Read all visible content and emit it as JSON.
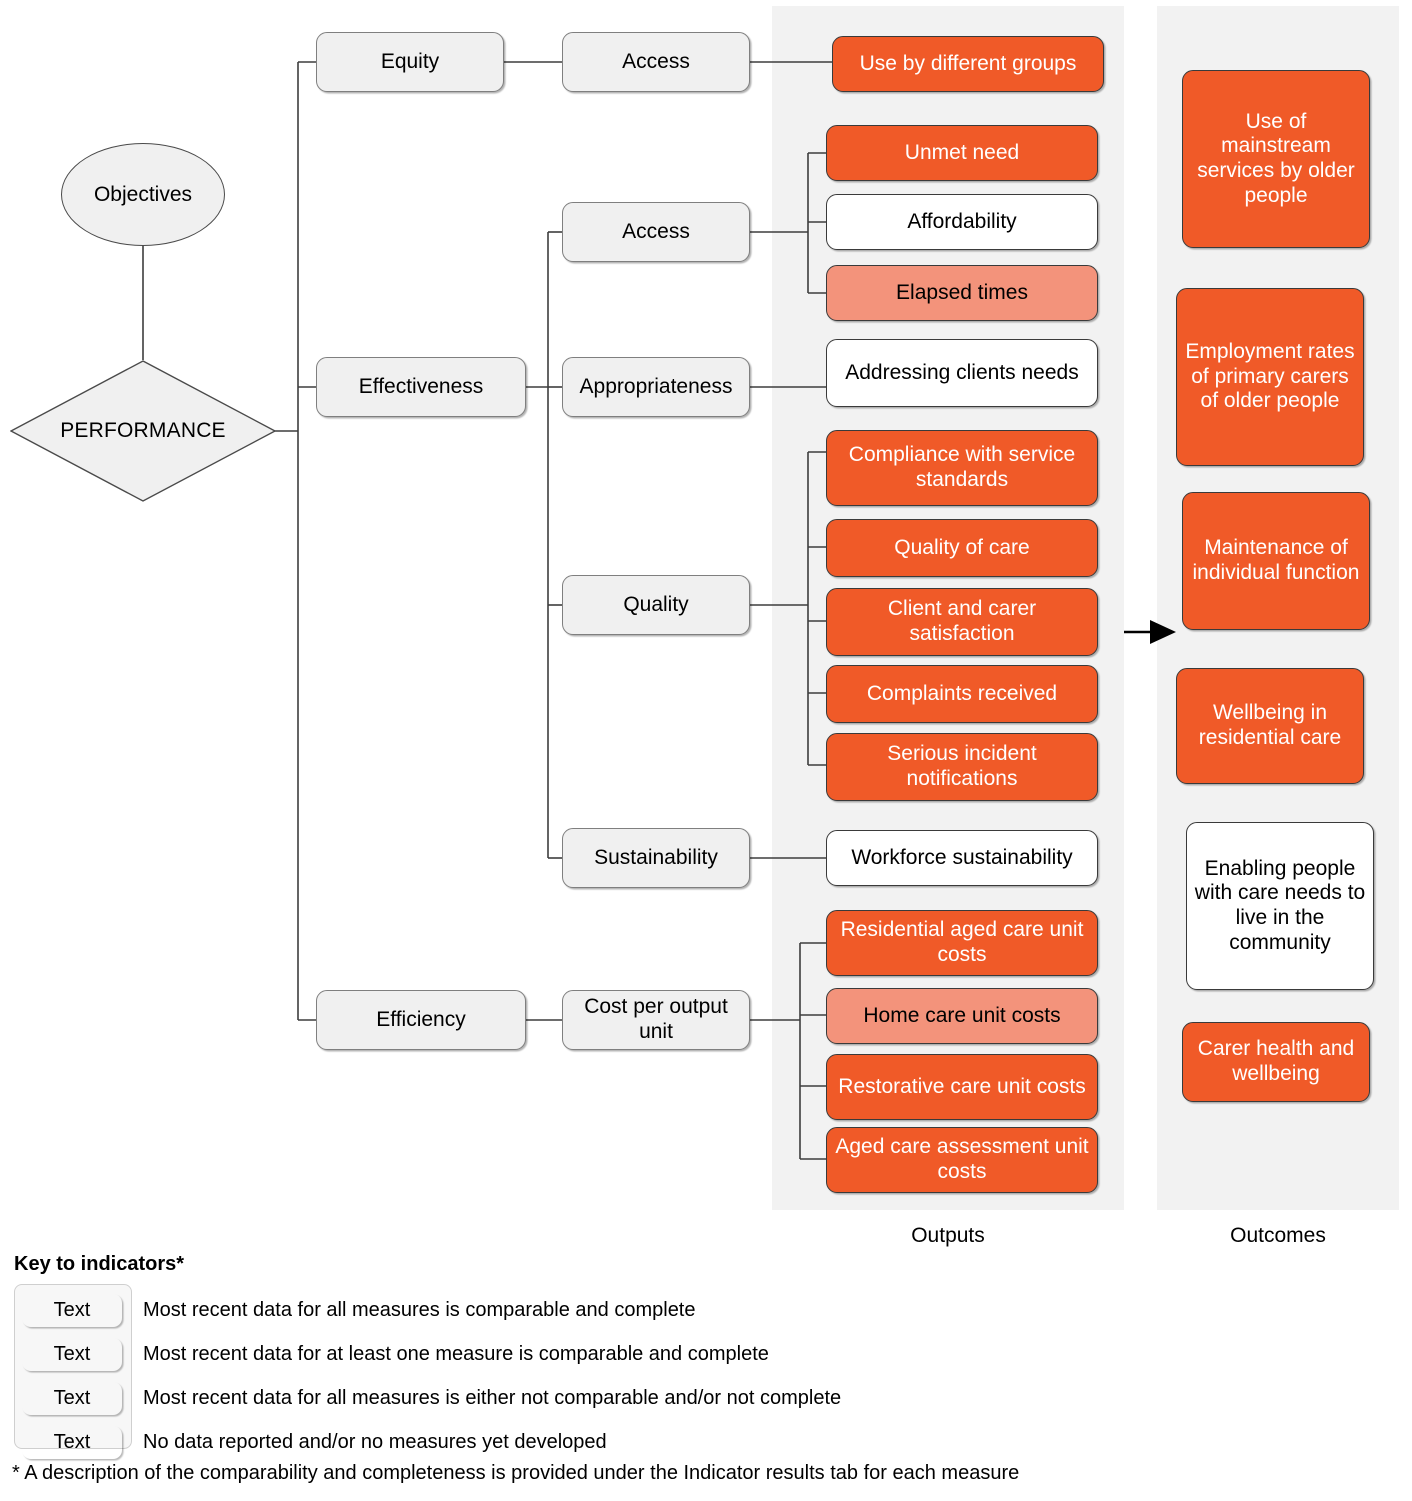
{
  "diagram": {
    "root": {
      "label": "PERFORMANCE"
    },
    "objectives": {
      "label": "Objectives"
    },
    "bands": {
      "outputs_label": "Outputs",
      "outcomes_label": "Outcomes"
    },
    "colors": {
      "deep_orange": "#F05A28",
      "mid_orange": "#F3937B",
      "pale_orange": "#FBDED2",
      "white": "#FFFFFF",
      "band_grey": "#F2F2F2",
      "node_grey": "#F0F0F0"
    },
    "level1": [
      {
        "label": "Equity"
      },
      {
        "label": "Effectiveness"
      },
      {
        "label": "Efficiency"
      }
    ],
    "level2": [
      {
        "label": "Access"
      },
      {
        "label": "Access"
      },
      {
        "label": "Appropriateness"
      },
      {
        "label": "Quality"
      },
      {
        "label": "Sustainability"
      },
      {
        "label": "Cost per output unit"
      }
    ],
    "outputs": [
      {
        "label": "Use by different groups",
        "status": "deep"
      },
      {
        "label": "Unmet need",
        "status": "deep"
      },
      {
        "label": "Affordability",
        "status": "none"
      },
      {
        "label": "Elapsed times",
        "status": "mid"
      },
      {
        "label": "Addressing clients needs",
        "status": "none"
      },
      {
        "label": "Compliance with service standards",
        "status": "deep"
      },
      {
        "label": "Quality of care",
        "status": "deep"
      },
      {
        "label": "Client and carer satisfaction",
        "status": "deep"
      },
      {
        "label": "Complaints received",
        "status": "deep"
      },
      {
        "label": "Serious incident notifications",
        "status": "deep"
      },
      {
        "label": "Workforce sustainability",
        "status": "none"
      },
      {
        "label": "Residential aged care unit costs",
        "status": "deep"
      },
      {
        "label": "Home care unit costs",
        "status": "mid"
      },
      {
        "label": "Restorative care unit costs",
        "status": "deep"
      },
      {
        "label": "Aged care assessment unit costs",
        "status": "deep"
      }
    ],
    "outcomes": [
      {
        "label": "Use of mainstream services by older people",
        "status": "deep"
      },
      {
        "label": "Employment rates of primary carers of older people",
        "status": "deep"
      },
      {
        "label": "Maintenance of individual function",
        "status": "deep"
      },
      {
        "label": "Wellbeing in residential care",
        "status": "deep"
      },
      {
        "label": "Enabling people with care needs to live in the community",
        "status": "none"
      },
      {
        "label": "Carer health and wellbeing",
        "status": "deep"
      }
    ]
  },
  "legend": {
    "title": "Key to indicators*",
    "swatch_text": "Text",
    "rows": [
      {
        "status": "deep",
        "text": "Most recent data for all measures is comparable and complete"
      },
      {
        "status": "mid",
        "text": "Most recent data for at least one measure is comparable and complete"
      },
      {
        "status": "pale",
        "text": "Most recent data for all measures is either not comparable and/or not complete"
      },
      {
        "status": "none",
        "text": "No data reported and/or no measures yet developed"
      }
    ],
    "footnote": "* A description of the comparability and completeness is provided under the Indicator results tab for each measure"
  }
}
